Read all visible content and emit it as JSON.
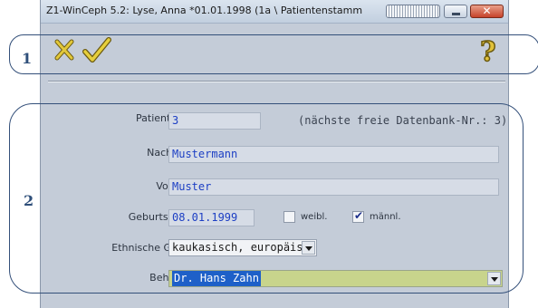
{
  "window": {
    "title": "Z1-WinCeph 5.2: Lyse, Anna *01.01.1998 (1a \\ Patientenstamm"
  },
  "toolbar": {
    "cancel_icon": "cancel-x-icon",
    "ok_icon": "checkmark-icon",
    "help_icon": "help-question-icon",
    "help_glyph": "?"
  },
  "callouts": {
    "one": "1",
    "two": "2"
  },
  "form": {
    "patient_no": {
      "label": "Patienten-Nr.:",
      "value": "3",
      "hint": "(nächste freie Datenbank-Nr.: 3)"
    },
    "surname": {
      "label": "Nachname:",
      "value": "Mustermann"
    },
    "firstname": {
      "label": "Vorname:",
      "value": "Muster"
    },
    "birthdate": {
      "label": "Geburtsdatum:",
      "value": "08.01.1999"
    },
    "gender": {
      "female_label": "weibl.",
      "female_checked": false,
      "male_label": "männl.",
      "male_checked": true
    },
    "ethnic": {
      "label": "Ethnische Gruppe:",
      "value": "kaukasisch, europäisch"
    },
    "practitioner": {
      "label": "Behandler:",
      "value": "Dr. Hans Zahn"
    }
  },
  "colors": {
    "accent_blue": "#1d3fc4",
    "selection": "#1e60c8",
    "highlight": "#c8d48c",
    "callout": "#34507a"
  }
}
